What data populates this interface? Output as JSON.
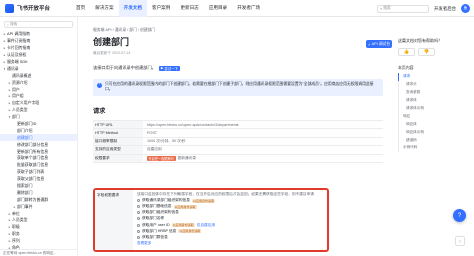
{
  "app": {
    "title": "飞书开放平台",
    "accent": "#3370ff",
    "highlight_border": "#e23b2e"
  },
  "topnav": {
    "items": [
      {
        "label": "首页",
        "active": false
      },
      {
        "label": "解决方案",
        "active": false
      },
      {
        "label": "开发文档",
        "active": true
      },
      {
        "label": "客户案例",
        "active": false
      },
      {
        "label": "更新日志",
        "active": false
      },
      {
        "label": "应用目录",
        "active": false
      },
      {
        "label": "开发者广场",
        "active": false
      }
    ],
    "search_placeholder": "搜索",
    "console_label": "开发者后台",
    "avatar": "鱼"
  },
  "sidebar": {
    "search_placeholder": "搜索",
    "items": [
      {
        "label": "API 调用指南",
        "level": 0,
        "caret": "▸",
        "selected": false
      },
      {
        "label": "事件订阅指南",
        "level": 0,
        "caret": "▸",
        "selected": false
      },
      {
        "label": "卡片回传指南",
        "level": 0,
        "caret": "▸",
        "selected": false
      },
      {
        "label": "认证及授权",
        "level": 0,
        "caret": "▸",
        "selected": false
      },
      {
        "label": "服务端 SDK",
        "level": 0,
        "caret": "▸",
        "selected": false
      },
      {
        "label": "通讯录",
        "level": 0,
        "caret": "▾",
        "selected": false
      },
      {
        "label": "通讯录概述",
        "level": 1,
        "caret": "",
        "selected": false
      },
      {
        "label": "资源介绍",
        "level": 1,
        "caret": "▸",
        "selected": false
      },
      {
        "label": "用户",
        "level": 1,
        "caret": "▸",
        "selected": false
      },
      {
        "label": "用户组",
        "level": 1,
        "caret": "▸",
        "selected": false
      },
      {
        "label": "自定义用户字段",
        "level": 1,
        "caret": "▸",
        "selected": false
      },
      {
        "label": "人员类型",
        "level": 1,
        "caret": "▸",
        "selected": false
      },
      {
        "label": "部门",
        "level": 1,
        "caret": "▾",
        "selected": false
      },
      {
        "label": "更新部门ID",
        "level": 2,
        "caret": "",
        "selected": false
      },
      {
        "label": "部门介绍",
        "level": 2,
        "caret": "",
        "selected": false
      },
      {
        "label": "创建部门",
        "level": 2,
        "caret": "",
        "selected": true
      },
      {
        "label": "修改部门部分信息",
        "level": 2,
        "caret": "",
        "selected": false
      },
      {
        "label": "更新部门所有信息",
        "level": 2,
        "caret": "",
        "selected": false
      },
      {
        "label": "获取单个部门信息",
        "level": 2,
        "caret": "",
        "selected": false
      },
      {
        "label": "批量获取部门信息",
        "level": 2,
        "caret": "",
        "selected": false
      },
      {
        "label": "获取子部门列表",
        "level": 2,
        "caret": "",
        "selected": false
      },
      {
        "label": "获取父部门信息",
        "level": 2,
        "caret": "",
        "selected": false
      },
      {
        "label": "搜索部门",
        "level": 2,
        "caret": "",
        "selected": false
      },
      {
        "label": "删除部门",
        "level": 2,
        "caret": "",
        "selected": false
      },
      {
        "label": "部门群转为普通群",
        "level": 2,
        "caret": "",
        "selected": false
      },
      {
        "label": "部门事件",
        "level": 2,
        "caret": "▸",
        "selected": false
      },
      {
        "label": "单位",
        "level": 1,
        "caret": "▸",
        "selected": false
      },
      {
        "label": "人员类型",
        "level": 1,
        "caret": "▸",
        "selected": false
      },
      {
        "label": "职级",
        "level": 1,
        "caret": "▸",
        "selected": false
      },
      {
        "label": "职务",
        "level": 1,
        "caret": "▸",
        "selected": false
      },
      {
        "label": "序列",
        "level": 1,
        "caret": "▸",
        "selected": false
      },
      {
        "label": "角色",
        "level": 1,
        "caret": "▸",
        "selected": false
      }
    ],
    "footer": "正在等待 open.feishu.cn 的响应..."
  },
  "main": {
    "breadcrumb": "服务端 API  /  通讯录  /  部门  /  创建部门",
    "title": "创建部门",
    "updated": "最后更新于 2023-07-14",
    "description": "该接口用于向通讯录中创建部门。",
    "try_it": "尝试一下",
    "notice": "只可在应用的通讯录权限范围内的部门下创建部门。若需要在根部门下创建子部门，则应用通讯录权限范围需要设置为\"全部成员\"。应用商店应用无权限调用此接口。",
    "request_heading": "请求",
    "request_rows": [
      {
        "key": "HTTP URL",
        "value": "https://open.feishu.cn/open-apis/contact/v3/departments",
        "tag": "",
        "note": ""
      },
      {
        "key": "HTTP Method",
        "value": "POST",
        "tag": "",
        "note": ""
      },
      {
        "key": "接口频率限制",
        "value": "1000 次/分钟、50 次/秒",
        "tag": "",
        "note": ""
      },
      {
        "key": "支持的应用类型",
        "value": "自建应用",
        "tag": "",
        "note": ""
      },
      {
        "key": "权限要求",
        "value": "更新通讯录",
        "tag": "开启任一权限即可",
        "note": ""
      }
    ],
    "fields": {
      "label": "字段权限要求",
      "intro": "该接口返回体中存在下列敏感字段，仅当开启对应的权限后才会返回；如果无需获取这些字段，则不建议申请",
      "items": [
        {
          "label": "获取通讯录部门组织架构信息",
          "tag": "以应用身份读取",
          "link": ""
        },
        {
          "label": "获取部门基础信息",
          "tag": "以应用身份读取",
          "link": ""
        },
        {
          "label": "获取部门组织架构信息",
          "tag": "",
          "link": ""
        },
        {
          "label": "获取部门名称",
          "tag": "",
          "link": ""
        },
        {
          "label": "获取用户 user ID",
          "tag": "以应用身份读取",
          "link": "仅自建应用"
        },
        {
          "label": "获取部门 HRBP 信息",
          "tag": "以应用身份读取",
          "link": ""
        },
        {
          "label": "获取部门群信息",
          "tag": "",
          "link": ""
        }
      ],
      "more": "查看更多"
    }
  },
  "rail": {
    "api_button": "API 调试台",
    "feedback_question": "这篇文档对您有帮助吗？",
    "thumb_up": "👍",
    "thumb_down": "👎",
    "toc_heading": "本页内容",
    "toc": [
      {
        "label": "请求",
        "sub": false,
        "active": true
      },
      {
        "label": "请求头",
        "sub": true,
        "active": false
      },
      {
        "label": "查询参数",
        "sub": true,
        "active": false
      },
      {
        "label": "请求体",
        "sub": true,
        "active": false
      },
      {
        "label": "请求体示例",
        "sub": true,
        "active": false
      },
      {
        "label": "响应",
        "sub": false,
        "active": false
      },
      {
        "label": "响应体",
        "sub": true,
        "active": false
      },
      {
        "label": "响应体示例",
        "sub": true,
        "active": false
      },
      {
        "label": "错误码",
        "sub": true,
        "active": false
      },
      {
        "label": "示例代码",
        "sub": false,
        "active": false
      }
    ],
    "float_help_icon": "?",
    "float_top_icon": "↑"
  }
}
